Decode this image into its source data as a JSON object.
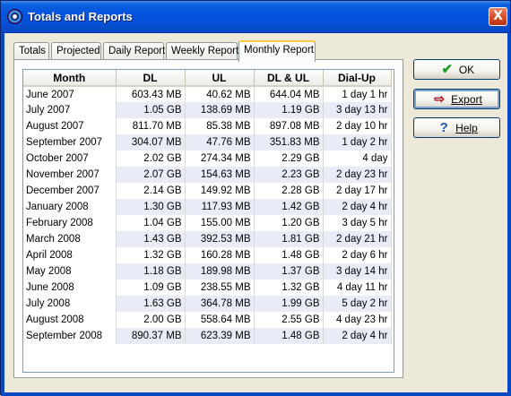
{
  "window": {
    "title": "Totals and Reports",
    "close_label": "X"
  },
  "tabs": [
    {
      "label": "Totals"
    },
    {
      "label": "Projected"
    },
    {
      "label": "Daily Report"
    },
    {
      "label": "Weekly Report"
    },
    {
      "label": "Monthly Report",
      "active": true
    }
  ],
  "buttons": {
    "ok": {
      "label": "OK",
      "icon": "check-icon"
    },
    "export": {
      "label": "Export",
      "icon": "export-icon"
    },
    "help": {
      "label": "Help",
      "icon": "help-icon"
    }
  },
  "table": {
    "columns": [
      "Month",
      "DL",
      "UL",
      "DL & UL",
      "Dial-Up"
    ],
    "rows": [
      [
        "June 2007",
        "603.43 MB",
        "40.62 MB",
        "644.04 MB",
        "1 day 1 hr"
      ],
      [
        "July 2007",
        "1.05 GB",
        "138.69 MB",
        "1.19 GB",
        "3 day 13 hr"
      ],
      [
        "August 2007",
        "811.70 MB",
        "85.38 MB",
        "897.08 MB",
        "2 day 10 hr"
      ],
      [
        "September 2007",
        "304.07 MB",
        "47.76 MB",
        "351.83 MB",
        "1 day 2 hr"
      ],
      [
        "October 2007",
        "2.02 GB",
        "274.34 MB",
        "2.29 GB",
        "4 day"
      ],
      [
        "November 2007",
        "2.07 GB",
        "154.63 MB",
        "2.23 GB",
        "2 day 23 hr"
      ],
      [
        "December 2007",
        "2.14 GB",
        "149.92 MB",
        "2.28 GB",
        "2 day 17 hr"
      ],
      [
        "January 2008",
        "1.30 GB",
        "117.93 MB",
        "1.42 GB",
        "2 day 4 hr"
      ],
      [
        "February 2008",
        "1.04 GB",
        "155.00 MB",
        "1.20 GB",
        "3 day 5 hr"
      ],
      [
        "March 2008",
        "1.43 GB",
        "392.53 MB",
        "1.81 GB",
        "2 day 21 hr"
      ],
      [
        "April 2008",
        "1.32 GB",
        "160.28 MB",
        "1.48 GB",
        "2 day 6 hr"
      ],
      [
        "May 2008",
        "1.18 GB",
        "189.98 MB",
        "1.37 GB",
        "3 day 14 hr"
      ],
      [
        "June 2008",
        "1.09 GB",
        "238.55 MB",
        "1.32 GB",
        "4 day 11 hr"
      ],
      [
        "July 2008",
        "1.63 GB",
        "364.78 MB",
        "1.99 GB",
        "5 day 2 hr"
      ],
      [
        "August 2008",
        "2.00 GB",
        "558.64 MB",
        "2.55 GB",
        "4 day 23 hr"
      ],
      [
        "September 2008",
        "890.37 MB",
        "623.39 MB",
        "1.48 GB",
        "2 day 4 hr"
      ]
    ]
  }
}
